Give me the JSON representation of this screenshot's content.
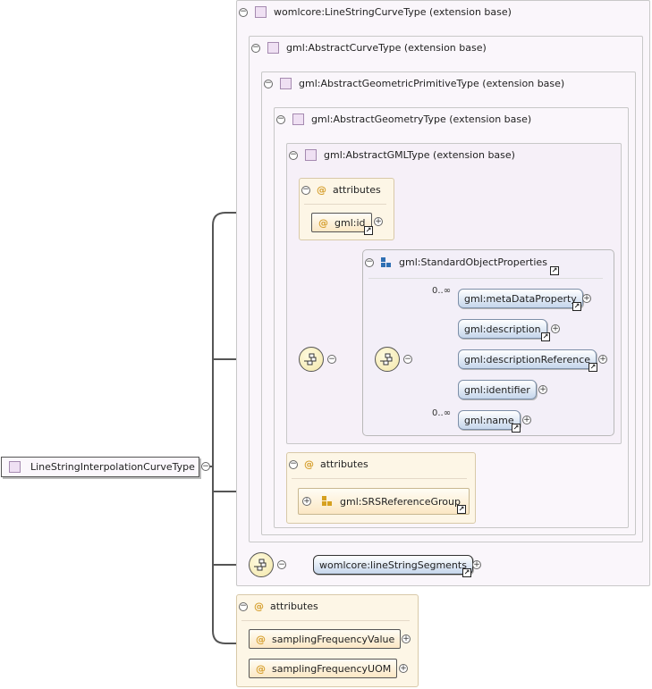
{
  "root": {
    "label": "LineStringInterpolationCurveType"
  },
  "extensions": [
    {
      "label": "womlcore:LineStringCurveType (extension base)"
    },
    {
      "label": "gml:AbstractCurveType (extension base)"
    },
    {
      "label": "gml:AbstractGeometricPrimitiveType (extension base)"
    },
    {
      "label": "gml:AbstractGeometryType (extension base)"
    },
    {
      "label": "gml:AbstractGMLType (extension base)"
    }
  ],
  "gml_attributes": {
    "title": "attributes",
    "items": [
      "gml:id"
    ]
  },
  "standard_props": {
    "title": "gml:StandardObjectProperties",
    "elements": [
      {
        "label": "gml:metaDataProperty",
        "occurs": "0..∞"
      },
      {
        "label": "gml:description",
        "occurs": ""
      },
      {
        "label": "gml:descriptionReference",
        "occurs": ""
      },
      {
        "label": "gml:identifier",
        "occurs": ""
      },
      {
        "label": "gml:name",
        "occurs": "0..∞"
      }
    ]
  },
  "geometry_attributes": {
    "title": "attributes",
    "group": "gml:SRSReferenceGroup"
  },
  "segments": {
    "label": "womlcore:lineStringSegments"
  },
  "own_attributes": {
    "title": "attributes",
    "items": [
      "samplingFrequencyValue",
      "samplingFrequencyUOM"
    ]
  },
  "colors": {
    "type_icon": "#efe0f3",
    "element_fill": "#c5d6ec",
    "attribute_fill": "#fbe7c4",
    "sequence_fill": "#f2e6a8"
  }
}
